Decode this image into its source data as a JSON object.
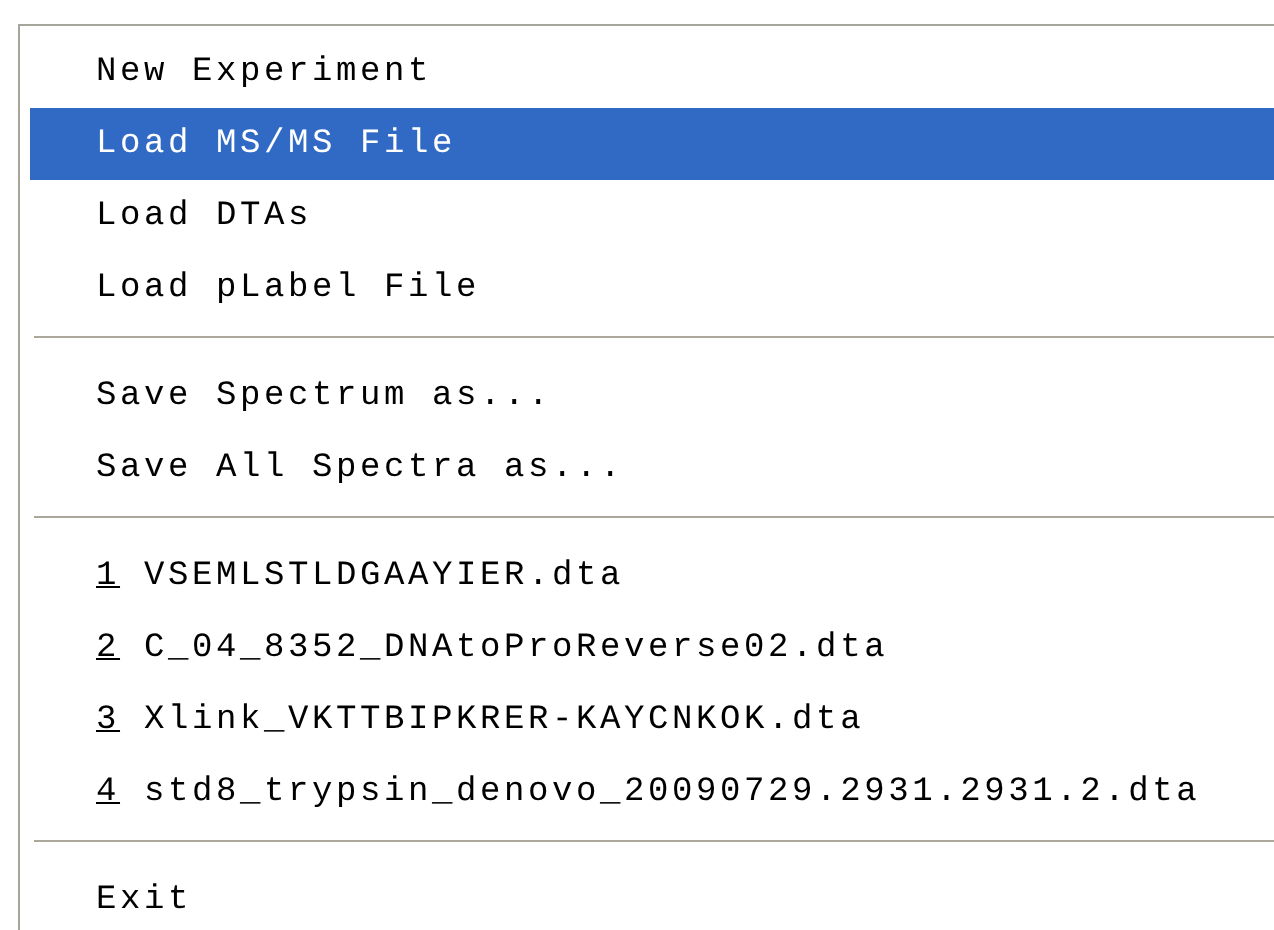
{
  "menu": {
    "groups": [
      [
        {
          "label": "New Experiment",
          "selected": false
        },
        {
          "label": "Load MS/MS File",
          "selected": true
        },
        {
          "label": "Load DTAs",
          "selected": false
        },
        {
          "label": "Load pLabel File",
          "selected": false
        }
      ],
      [
        {
          "label": "Save Spectrum as...",
          "selected": false
        },
        {
          "label": "Save All Spectra as...",
          "selected": false
        }
      ],
      [
        {
          "accelerator": "1",
          "label": "VSEMLSTLDGAAYIER.dta",
          "selected": false
        },
        {
          "accelerator": "2",
          "label": "C_04_8352_DNAtoProReverse02.dta",
          "selected": false
        },
        {
          "accelerator": "3",
          "label": "Xlink_VKTTBIPKRER-KAYCNKOK.dta",
          "selected": false
        },
        {
          "accelerator": "4",
          "label": "std8_trypsin_denovo_20090729.2931.2931.2.dta",
          "selected": false
        }
      ],
      [
        {
          "label": "Exit",
          "selected": false
        }
      ]
    ]
  }
}
